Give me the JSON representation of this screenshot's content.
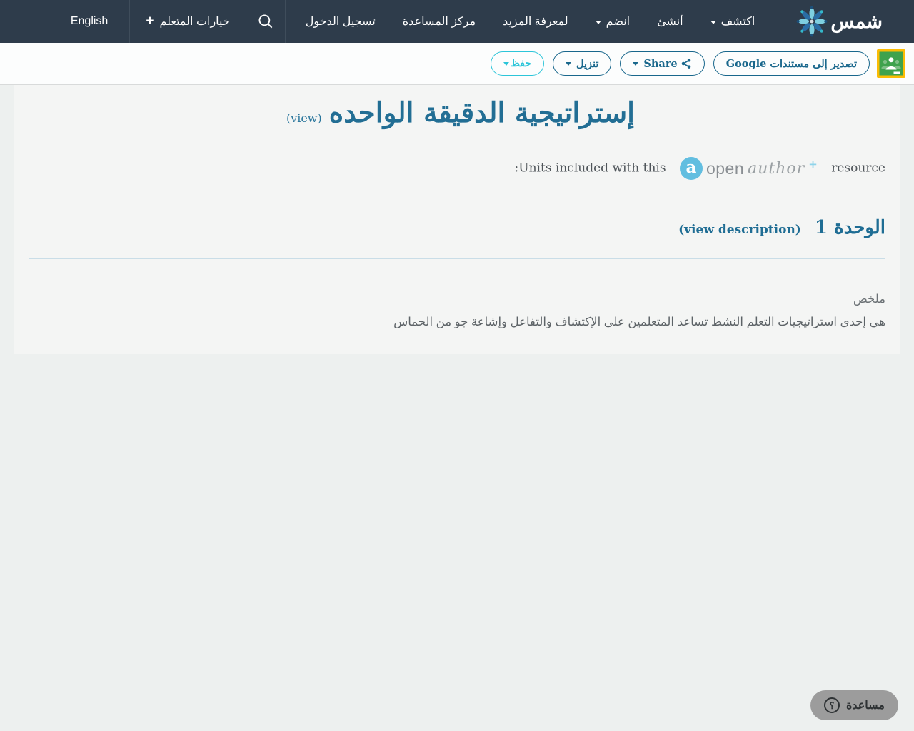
{
  "navbar": {
    "brand": "شمس",
    "items": [
      {
        "label": "اكتشف",
        "has_dropdown": true
      },
      {
        "label": "أنشئ",
        "has_dropdown": false
      },
      {
        "label": "انضم",
        "has_dropdown": true
      },
      {
        "label": "لمعرفة المزيد",
        "has_dropdown": false
      },
      {
        "label": "مركز المساعدة",
        "has_dropdown": false
      },
      {
        "label": "تسجيل الدخول",
        "has_dropdown": false
      }
    ],
    "learner_options_label": "خيارات المتعلم",
    "language_label": "English"
  },
  "toolbar": {
    "export_google_label": "تصدير إلى مستندات Google",
    "share_label": "Share",
    "download_label": "تنزيل",
    "save_label": "حفظ"
  },
  "content": {
    "title": "إستراتيجية الدقيقة الواحده",
    "title_view_link": "(view)",
    "units_text_before": "Units included with this",
    "units_text_after": "resource:",
    "openauthor": {
      "a": "a",
      "open": "open",
      "author": "author",
      "plus": "+"
    },
    "unit_heading": "الوحدة 1",
    "unit_view_link": "(view description)",
    "summary_label": "ملخص",
    "summary_text": "هي إحدى استراتيجيات التعلم النشط تساعد المتعلمين على الإكتشاف والتفاعل وإشاعة جو من الحماس"
  },
  "help": {
    "label": "مساعدة",
    "icon_glyph": "؟"
  },
  "icons": {
    "plus_glyph": "+"
  },
  "colors": {
    "navbar_bg": "#2e3c4b",
    "teal_primary": "#19678c",
    "title_teal": "#226e94",
    "save_cyan": "#2cc5d9",
    "classroom_green": "#3ea24d",
    "classroom_yellow": "#fbbc04",
    "help_gray": "#9c9c9c"
  }
}
